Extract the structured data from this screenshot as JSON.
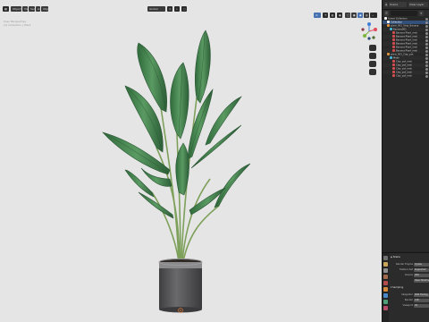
{
  "header": {
    "left_buttons": [
      "Object Mode",
      "View",
      "Select",
      "Add",
      "Object"
    ],
    "orientation": "Global",
    "right_label": "Scene"
  },
  "overlay": {
    "lines": [
      "User Perspective",
      "(1) Collection | Plant"
    ]
  },
  "topbar": {
    "scene": "Scene",
    "layer": "View Layer"
  },
  "outliner": {
    "rows": [
      {
        "label": "Scene Collection",
        "indent": 0,
        "icon": "collection-icon",
        "color": "#ffffff"
      },
      {
        "label": "Collection",
        "indent": 1,
        "icon": "collection-icon",
        "color": "#ffffff",
        "selected": true
      },
      {
        "label": "plant_001_Strip_Banana",
        "indent": 1,
        "icon": "object-icon",
        "color": "#e0943f"
      },
      {
        "label": "Banana001",
        "indent": 2,
        "icon": "mesh-icon",
        "color": "#43b4d8"
      },
      {
        "label": "Banana Plant_mat",
        "indent": 3,
        "icon": "material-icon",
        "color": "#d64d4d"
      },
      {
        "label": "Banana Plant_mat",
        "indent": 3,
        "icon": "material-icon",
        "color": "#d64d4d"
      },
      {
        "label": "Banana Plant_mat",
        "indent": 3,
        "icon": "material-icon",
        "color": "#d64d4d"
      },
      {
        "label": "Banana Plant_mat",
        "indent": 3,
        "icon": "material-icon",
        "color": "#d64d4d"
      },
      {
        "label": "Banana Plant_mat",
        "indent": 3,
        "icon": "material-icon",
        "color": "#d64d4d"
      },
      {
        "label": "Banana Plant_mat",
        "indent": 3,
        "icon": "material-icon",
        "color": "#d64d4d"
      },
      {
        "label": "plant_001_Clay_pot",
        "indent": 1,
        "icon": "object-icon",
        "color": "#e0943f"
      },
      {
        "label": "Mesh",
        "indent": 2,
        "icon": "mesh-icon",
        "color": "#43b4d8"
      },
      {
        "label": "Clay_pot_mat",
        "indent": 3,
        "icon": "material-icon",
        "color": "#d64d4d"
      },
      {
        "label": "Clay_pot_mat",
        "indent": 3,
        "icon": "material-icon",
        "color": "#d64d4d"
      },
      {
        "label": "Clay_pot_mat",
        "indent": 3,
        "icon": "material-icon",
        "color": "#d64d4d"
      },
      {
        "label": "Clay_pot_mat",
        "indent": 3,
        "icon": "material-icon",
        "color": "#d64d4d"
      },
      {
        "label": "Clay_pot_mat",
        "indent": 3,
        "icon": "material-icon",
        "color": "#d64d4d"
      }
    ]
  },
  "properties": {
    "title": "Scene",
    "rows": [
      {
        "label": "Render Engine",
        "value": "Cycles"
      },
      {
        "label": "Feature Set",
        "value": "Supported"
      },
      {
        "label": "Device",
        "value": "CPU"
      },
      {
        "label": "",
        "value": "Open Shading"
      }
    ],
    "section": "Sampling",
    "sub_rows": [
      {
        "label": "Integrator",
        "value": "Path Tracing"
      },
      {
        "label": "Render",
        "value": "128"
      },
      {
        "label": "Viewport",
        "value": "32"
      }
    ]
  },
  "colors": {
    "viewport_bg": "#e6e5e6",
    "leaf": "#3e7a4a",
    "pot": "#5a5a5c",
    "accent": "#4672b2"
  }
}
